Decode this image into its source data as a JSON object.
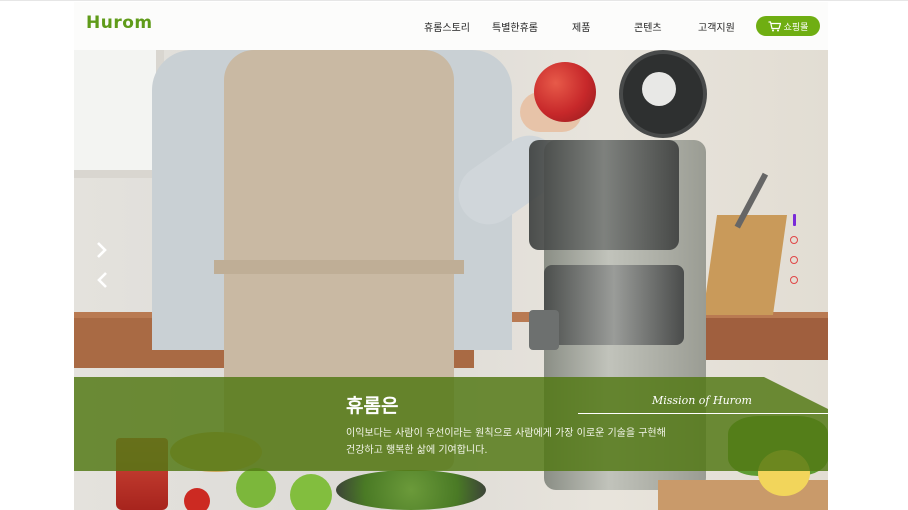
{
  "header": {
    "logo": "Hurom",
    "nav": [
      "휴롬스토리",
      "특별한휴롬",
      "제품",
      "콘텐츠",
      "고객지원"
    ],
    "shop_label": "쇼핑몰",
    "shop_icon": "cart-icon",
    "brand_color": "#6fae12"
  },
  "hero": {
    "next_icon": "chevron-right-icon",
    "prev_icon": "chevron-left-icon",
    "slides_total": 4,
    "active_slide": 1,
    "pager_color": "#e04646",
    "pager_active_color": "#7a2bd8"
  },
  "mission": {
    "title": "휴롬은",
    "line1": "이익보다는 사람이 우선이라는 원칙으로 사람에게 가장 이로운 기술을 구현해",
    "line2": "건강하고 행복한 삶에 기여합니다.",
    "tag": "Mission of Hurom",
    "overlay_color": "#527814"
  }
}
